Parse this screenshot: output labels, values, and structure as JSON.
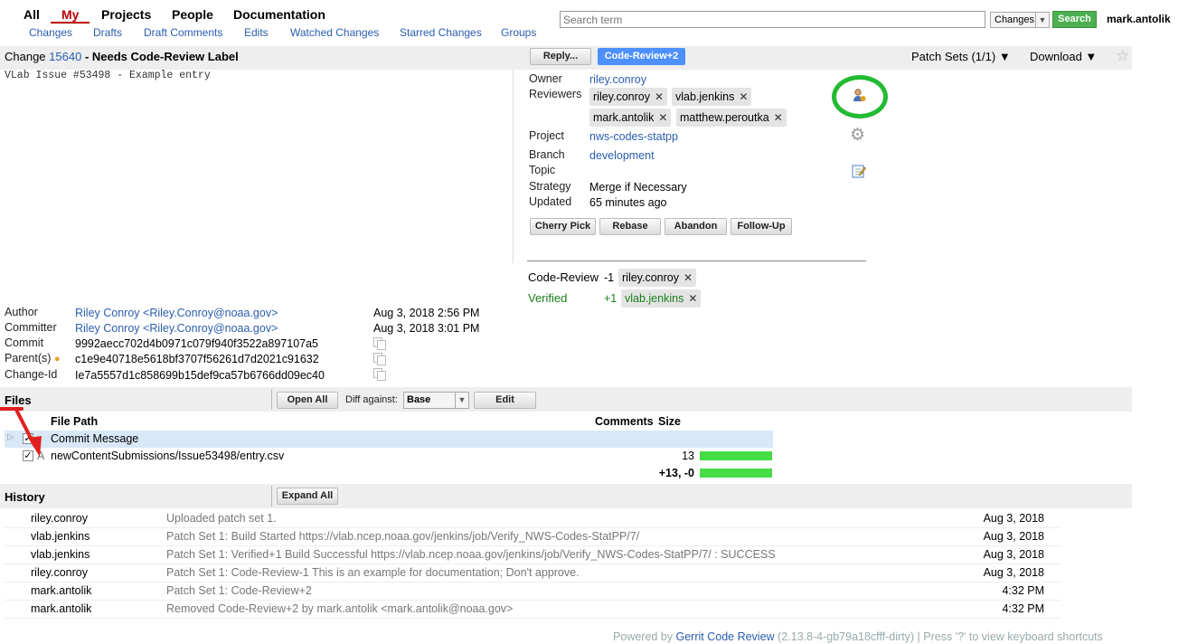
{
  "topmenu": {
    "all": "All",
    "my": "My",
    "projects": "Projects",
    "people": "People",
    "documentation": "Documentation"
  },
  "submenu": {
    "changes": "Changes",
    "drafts": "Drafts",
    "draft_comments": "Draft Comments",
    "edits": "Edits",
    "watched": "Watched Changes",
    "starred": "Starred Changes",
    "groups": "Groups"
  },
  "search": {
    "placeholder": "Search term",
    "scope": "Changes",
    "button": "Search",
    "user": "mark.antolik"
  },
  "header": {
    "change_prefix": "Change",
    "change_num": "15640",
    "title": "- Needs Code-Review Label",
    "reply": "Reply...",
    "codereview_btn": "Code-Review+2",
    "patch_sets": "Patch Sets (1/1) ▼",
    "download": "Download ▼"
  },
  "commit_msg": "VLab Issue #53498 - Example entry",
  "info": {
    "owner_label": "Owner",
    "owner": "riley.conroy",
    "reviewers_label": "Reviewers",
    "reviewers": [
      "riley.conroy",
      "vlab.jenkins",
      "mark.antolik",
      "matthew.peroutka"
    ],
    "project_label": "Project",
    "project": "nws-codes-statpp",
    "branch_label": "Branch",
    "branch": "development",
    "topic_label": "Topic",
    "strategy_label": "Strategy",
    "strategy": "Merge if Necessary",
    "updated_label": "Updated",
    "updated": "65 minutes ago",
    "actions": [
      "Cherry Pick",
      "Rebase",
      "Abandon",
      "Follow-Up"
    ]
  },
  "labels": {
    "cr_label": "Code-Review",
    "cr_score": "-1",
    "cr_user": "riley.conroy",
    "v_label": "Verified",
    "v_score": "+1",
    "v_user": "vlab.jenkins"
  },
  "meta": {
    "author_label": "Author",
    "author": "Riley Conroy <Riley.Conroy@noaa.gov>",
    "author_date": "Aug 3, 2018 2:56 PM",
    "committer_label": "Committer",
    "committer": "Riley Conroy <Riley.Conroy@noaa.gov>",
    "committer_date": "Aug 3, 2018 3:01 PM",
    "commit_label": "Commit",
    "commit": "9992aecc702d4b0971c079f940f3522a897107a5",
    "parent_label": "Parent(s)",
    "parent": "c1e9e40718e5618bf3707f56261d7d2021c91632",
    "changeid_label": "Change-Id",
    "changeid": "Ie7a5557d1c858699b15def9ca57b6766dd09ec40"
  },
  "files": {
    "title": "Files",
    "open_all": "Open All",
    "diff_against": "Diff against:",
    "diff_base": "Base",
    "edit": "Edit",
    "col_path": "File Path",
    "col_comments": "Comments",
    "col_size": "Size",
    "rows": [
      {
        "status": "",
        "path": "Commit Message",
        "size": ""
      },
      {
        "status": "A",
        "path": "newContentSubmissions/Issue53498/entry.csv",
        "size": "13"
      }
    ],
    "total": "+13, -0"
  },
  "history": {
    "title": "History",
    "expand_all": "Expand All",
    "rows": [
      {
        "who": "riley.conroy",
        "msg": "Uploaded patch set 1.",
        "when": "Aug 3, 2018"
      },
      {
        "who": "vlab.jenkins",
        "msg": "Patch Set 1: Build Started https://vlab.ncep.noaa.gov/jenkins/job/Verify_NWS-Codes-StatPP/7/",
        "when": "Aug 3, 2018"
      },
      {
        "who": "vlab.jenkins",
        "msg": "Patch Set 1: Verified+1 Build Successful https://vlab.ncep.noaa.gov/jenkins/job/Verify_NWS-Codes-StatPP/7/ : SUCCESS",
        "when": "Aug 3, 2018"
      },
      {
        "who": "riley.conroy",
        "msg": "Patch Set 1: Code-Review-1 This is an example for documentation; Don't approve.",
        "when": "Aug 3, 2018"
      },
      {
        "who": "mark.antolik",
        "msg": "Patch Set 1: Code-Review+2",
        "when": "4:32 PM"
      },
      {
        "who": "mark.antolik",
        "msg": "Removed Code-Review+2 by mark.antolik <mark.antolik@noaa.gov>",
        "when": "4:32 PM"
      }
    ]
  },
  "footer": {
    "powered": "Powered by",
    "gerrit": "Gerrit Code Review",
    "version": "(2.13.8-4-gb79a18cfff-dirty) | Press '?' to view keyboard shortcuts"
  },
  "colors": {
    "accent": "#2a5db0",
    "green": "#1a7f1a",
    "bar": "#44dd44",
    "annotation": "#e02020",
    "circle": "#22bb33"
  }
}
